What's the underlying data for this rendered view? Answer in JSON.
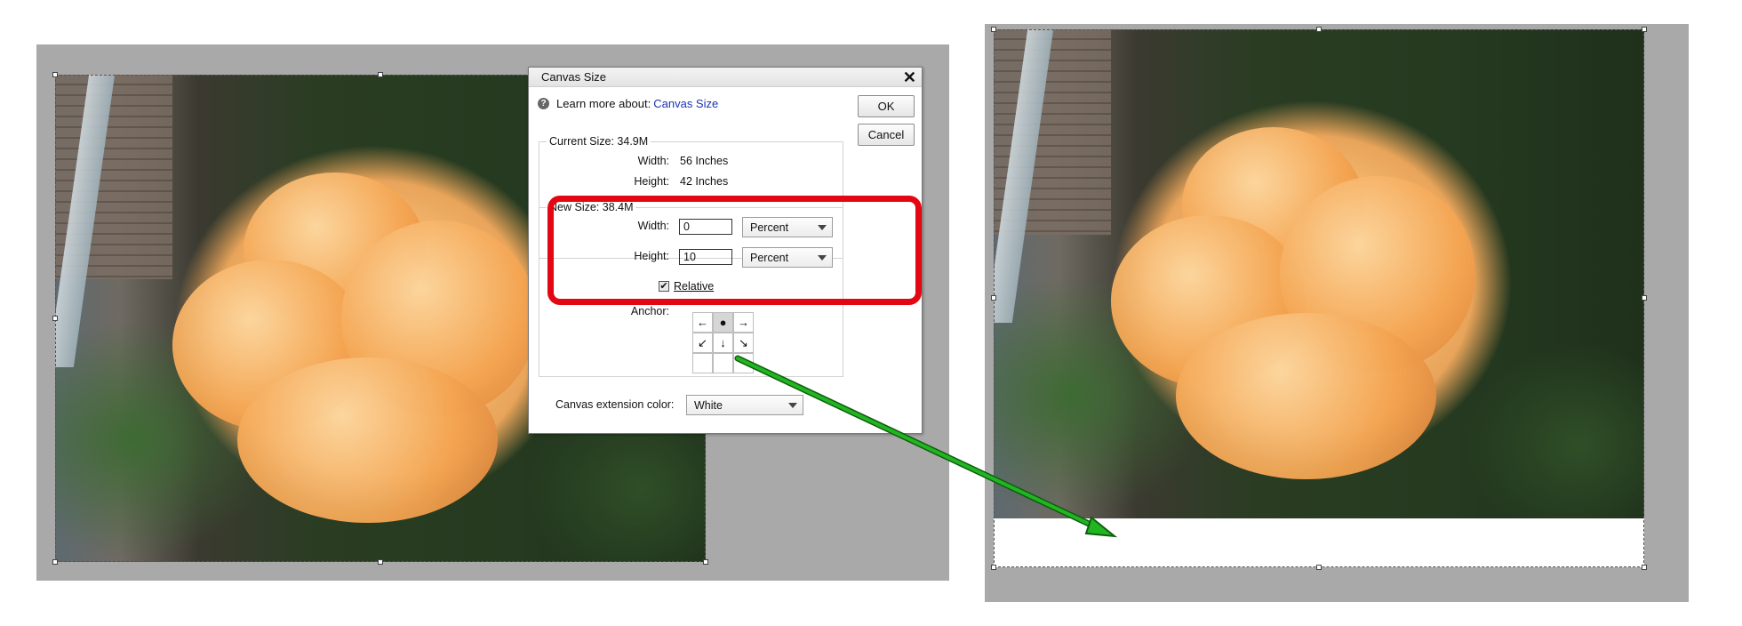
{
  "colors": {
    "highlight": "#e30613",
    "arrow": "#1fa81f",
    "link": "#1c32b8"
  },
  "dialog": {
    "title": "Canvas Size",
    "close_icon": "close-icon",
    "help_prefix": "Learn more about:",
    "help_link": "Canvas Size",
    "ok_label": "OK",
    "cancel_label": "Cancel",
    "current": {
      "title": "Current Size: 34.9M",
      "width_label": "Width:",
      "width_value": "56 Inches",
      "height_label": "Height:",
      "height_value": "42 Inches"
    },
    "new": {
      "title": "New Size: 38.4M",
      "width_label": "Width:",
      "width_value": "0",
      "width_unit": "Percent",
      "height_label": "Height:",
      "height_value": "10",
      "height_unit": "Percent",
      "relative_label": "Relative",
      "relative_checked": true
    },
    "anchor_label": "Anchor:",
    "anchor_icons": [
      "arrow-left-icon",
      "anchor-point-icon",
      "arrow-right-icon",
      "arrow-down-left-icon",
      "arrow-down-icon",
      "arrow-down-right-icon",
      "",
      "",
      ""
    ],
    "extension_label": "Canvas extension color:",
    "extension_value": "White"
  }
}
